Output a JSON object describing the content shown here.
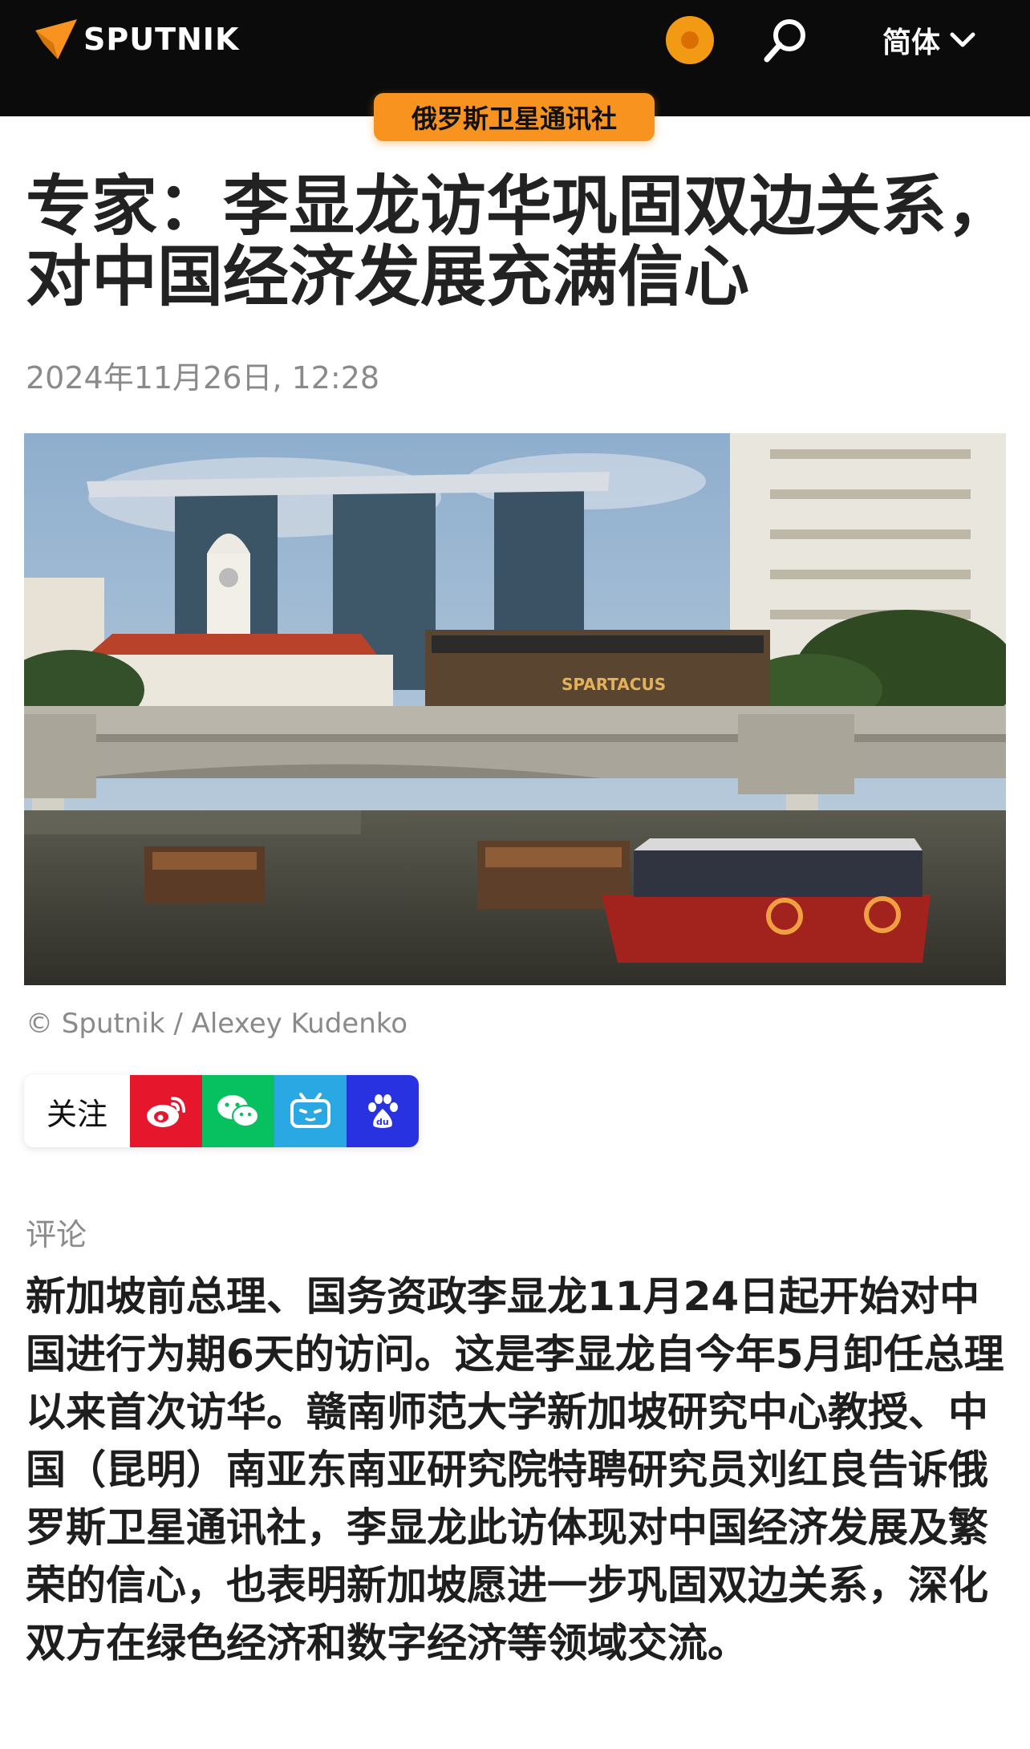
{
  "header": {
    "logo_text": "SPUTNIK",
    "language": "简体",
    "brand_color": "#f7931e"
  },
  "badge": "俄罗斯卫星通讯社",
  "article": {
    "title": "专家：李显龙访华巩固双边关系，对中国经济发展充满信心",
    "date": "2024年11月26日, 12:28",
    "photo_credit": "© Sputnik / Alexey Kudenko",
    "follow_label": "关注",
    "social_icons": [
      "weibo-icon",
      "wechat-icon",
      "bilibili-icon",
      "baidu-icon"
    ],
    "section": "评论",
    "body": "新加坡前总理、国务资政李显龙11月24日起开始对中国进行为期6天的访问。这是李显龙自今年5月卸任总理以来首次访华。赣南师范大学新加坡研究中心教授、中国（昆明）南亚东南亚研究院特聘研究员刘红良告诉俄罗斯卫星通讯社，李显龙此访体现对中国经济发展及繁荣的信心，也表明新加坡愿进一步巩固双边关系，深化双方在绿色经济和数字经济等领域交流。"
  }
}
